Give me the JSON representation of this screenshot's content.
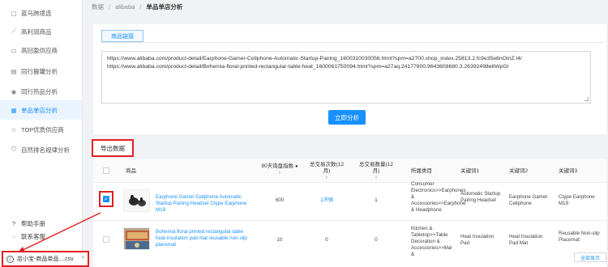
{
  "sidebar": {
    "items": [
      {
        "label": "蓝马跨境选",
        "icon": "file-icon"
      },
      {
        "label": "高利润商品",
        "icon": "trend-icon"
      },
      {
        "label": "高回盈供应商",
        "icon": "briefcase-icon"
      },
      {
        "label": "同行搬罐分析",
        "icon": "doc-icon"
      },
      {
        "label": "同行热品分析",
        "icon": "target-icon"
      },
      {
        "label": "单品单店分析",
        "icon": "chart-icon"
      },
      {
        "label": "TOP优质供应商",
        "icon": "star-icon"
      },
      {
        "label": "自然排名规律分析",
        "icon": "shield-icon"
      }
    ],
    "active_index": 5,
    "footer": [
      {
        "label": "帮助手册",
        "icon": "help-icon"
      },
      {
        "label": "联系客服",
        "icon": "chat-icon"
      }
    ]
  },
  "breadcrumb": {
    "items": [
      "数据",
      "alibaba",
      "单品单店分析"
    ]
  },
  "panel": {
    "tab_label": "商品链接",
    "urls": [
      "https://www.alibaba.com/product-detail/Earphone-Gamer-Cellphone-Automatic-Startup-Pairing_1600310030056.html?spm=a2700.shop_index.25813.2.fc9e35e8nOmZ.l4/",
      "https://www.alibaba.com/product-detail/Bohemia-floral-printed-rectangular-table-heat_1600061750094.html?spm=a27aq.24177800.9643608680.3.26392498e6WpGl"
    ],
    "analyze_button": "立即分析"
  },
  "export_button": "导出数据",
  "table": {
    "headers": [
      "商品",
      "90天询盘指数",
      "总交易次数(12月)",
      "总交易数量(12月)",
      "所属类目",
      "关键词1",
      "关键词2",
      "关键词3"
    ],
    "rows": [
      {
        "checked": true,
        "title": "Earphone Gamer Cellphone Automatic Startup Pairing Headset Ctype Earphone M19",
        "inquiry": "600",
        "trades": "1济镜",
        "quantity": "1",
        "category": "Consumer Electronics>>Earphones & Accessories>>Earphone & Headphone",
        "kw1": "Automatic Startup Pairing Headset",
        "kw2": "Earphone Gamer Cellphone",
        "kw3": "Ctype Earphone M19"
      },
      {
        "checked": false,
        "title": "Bohemia floral printed rectangular table heat insulation pad mat reusable non-slip placemat",
        "inquiry": "10",
        "trades": "0",
        "quantity": "0",
        "category": "Kitchen & Tabletop>>Table Decoration & Accessories>>Mats &",
        "kw1": "Heat Insulation Pad",
        "kw2": "Heat Insulation Pad Mat",
        "kw3": "Reusable Non-slip Placemat"
      }
    ],
    "show_all": "全部显示"
  },
  "download": {
    "filename": "店小宝-商品单品....csv"
  },
  "colors": {
    "accent": "#1890ff",
    "highlight": "#e02020"
  }
}
